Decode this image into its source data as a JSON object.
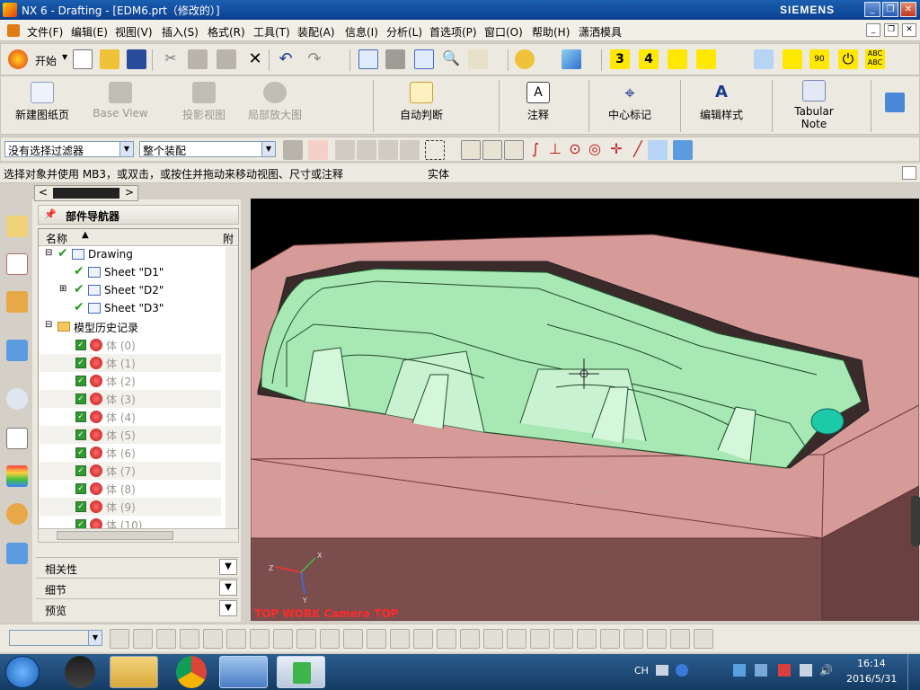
{
  "titlebar": {
    "title": "NX 6 - Drafting - [EDM6.prt（修改的）]",
    "brand": "SIEMENS"
  },
  "menu": [
    "文件(F)",
    "编辑(E)",
    "视图(V)",
    "插入(S)",
    "格式(R)",
    "工具(T)",
    "装配(A)",
    "信息(I)",
    "分析(L)",
    "首选项(P)",
    "窗口(O)",
    "帮助(H)",
    "潇洒模具"
  ],
  "toolbar1": {
    "start_label": "开始"
  },
  "ribbon": {
    "new_sheet": "新建图纸页",
    "base_view": "Base View",
    "proj_view": "投影视图",
    "detail_view": "局部放大图",
    "auto_dim": "自动判断",
    "note": "注释",
    "center_mark": "中心标记",
    "edit_style": "编辑样式",
    "tabular_note_1": "Tabular",
    "tabular_note_2": "Note"
  },
  "filters": {
    "selection_filter": "没有选择过滤器",
    "scope": "整个装配"
  },
  "cue": {
    "message": "选择对象并使用 MB3，或双击，或按住并拖动来移动视图、尺寸或注释",
    "status": "实体"
  },
  "navigator": {
    "title": "部件导航器",
    "col_name": "名称",
    "col_attach": "附",
    "drawing": "Drawing",
    "sheets": [
      "Sheet \"D1\"",
      "Sheet \"D2\"",
      "Sheet \"D3\""
    ],
    "history": "模型历史记录",
    "bodies": [
      "体 (0)",
      "体 (1)",
      "体 (2)",
      "体 (3)",
      "体 (4)",
      "体 (5)",
      "体 (6)",
      "体 (7)",
      "体 (8)",
      "体 (9)",
      "体 (10)"
    ],
    "sections": {
      "dependencies": "相关性",
      "details": "细节",
      "preview": "预览"
    }
  },
  "viewport": {
    "view_label": "TOP WORK Camera TOP",
    "label_color": "#ff2a2a"
  },
  "taskbar": {
    "lang": "CH",
    "time": "16:14",
    "date": "2016/5/31"
  },
  "colors": {
    "mold_pink": "#d69a98",
    "part_green": "#a8e8b4",
    "accent_teal": "#1cc9a8"
  },
  "icons": [
    "start-orb-icon",
    "qq-icon",
    "explorer-icon",
    "chrome-icon",
    "nx-icon",
    "camtasia-icon"
  ]
}
